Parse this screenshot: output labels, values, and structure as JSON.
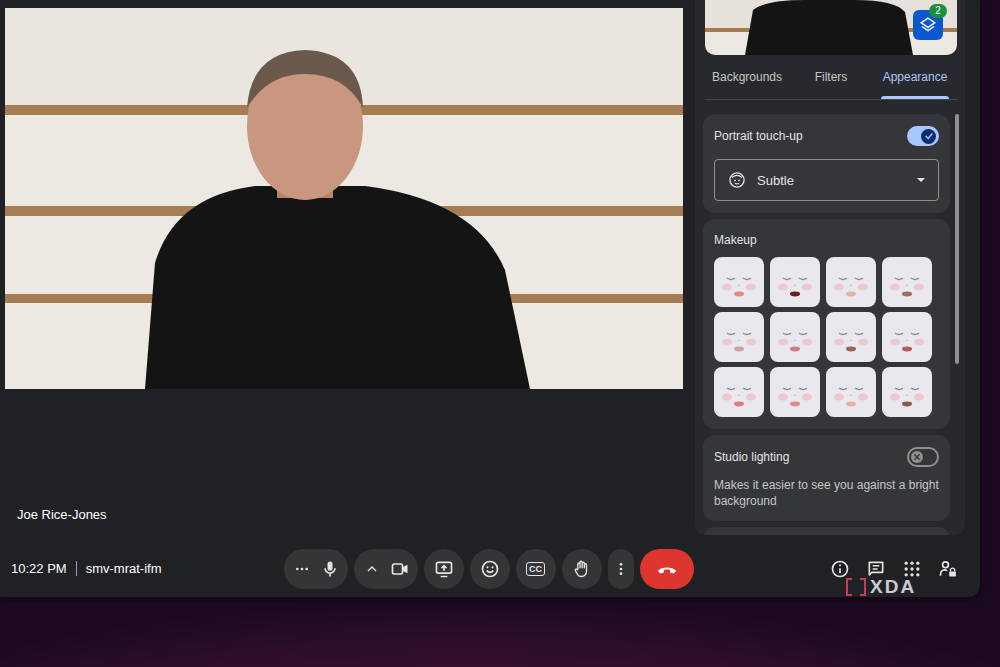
{
  "preview": {
    "badge": "2"
  },
  "tabs": [
    {
      "label": "Backgrounds",
      "selected": false
    },
    {
      "label": "Filters",
      "selected": false
    },
    {
      "label": "Appearance",
      "selected": true
    }
  ],
  "portrait_touch_up": {
    "label": "Portrait touch-up",
    "on": true,
    "dropdown": {
      "value": "Subtle"
    }
  },
  "makeup": {
    "title": "Makeup",
    "options": [
      {
        "selected": false,
        "color": "#e58a84"
      },
      {
        "selected": false,
        "color": "#6b1f24"
      },
      {
        "selected": false,
        "color": "#e6b3a6"
      },
      {
        "selected": false,
        "color": "#9a6d65"
      },
      {
        "selected": false,
        "color": "#c9a5a2"
      },
      {
        "selected": false,
        "color": "#d07a8a"
      },
      {
        "selected": false,
        "color": "#a0605a"
      },
      {
        "selected": false,
        "color": "#b65a5a"
      },
      {
        "selected": false,
        "color": "#e07a80"
      },
      {
        "selected": false,
        "color": "#d98e8a"
      },
      {
        "selected": false,
        "color": "#e8b0aa"
      },
      {
        "selected": false,
        "color": "#8a5a50"
      }
    ]
  },
  "studio_lighting": {
    "label": "Studio lighting",
    "on": false,
    "description": "Makes it easier to see you against a bright background"
  },
  "participant": {
    "name": "Joe Rice-Jones"
  },
  "meeting": {
    "time": "10:22 PM",
    "code": "smv-mrat-ifm"
  },
  "controls": {
    "mic_on": true,
    "camera_on": true,
    "captions_label": "CC"
  },
  "watermark": {
    "text": "XDA"
  }
}
